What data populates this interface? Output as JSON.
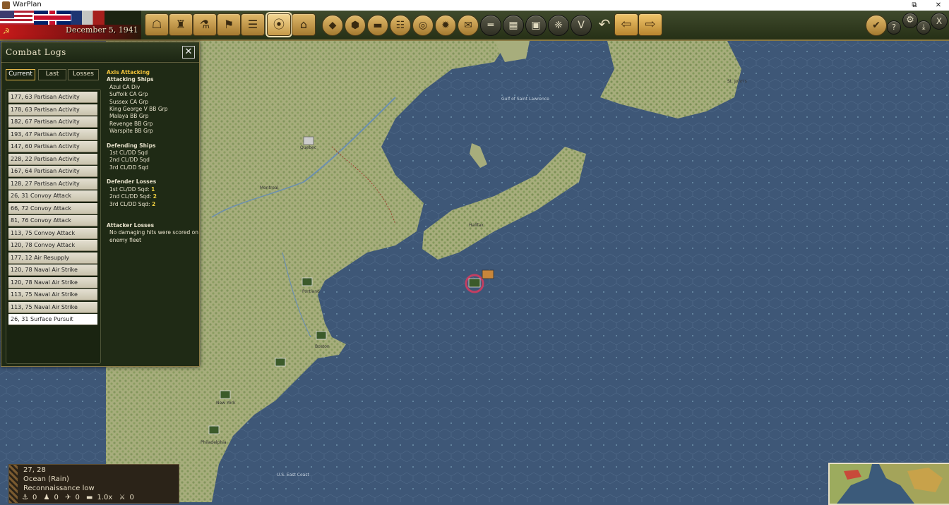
{
  "window": {
    "title": "WarPlan",
    "controls": [
      "–",
      "⧉",
      "✕"
    ]
  },
  "toolbar": {
    "date": "December 5, 1941",
    "main_buttons": [
      {
        "name": "production-button",
        "glyph": "☖"
      },
      {
        "name": "units-button",
        "glyph": "♜"
      },
      {
        "name": "research-button",
        "glyph": "⚗"
      },
      {
        "name": "diplomacy-flag-button",
        "glyph": "⚑"
      },
      {
        "name": "reports-button",
        "glyph": "☰"
      },
      {
        "name": "combat-logs-button",
        "glyph": "⦿"
      },
      {
        "name": "helmet-button",
        "glyph": "⌂"
      }
    ],
    "round_buttons": [
      {
        "name": "terrain-filter-button",
        "glyph": "◆"
      },
      {
        "name": "hex-filter-button",
        "glyph": "⬢"
      },
      {
        "name": "tank-filter-button",
        "glyph": "▬"
      },
      {
        "name": "supply-filter-button",
        "glyph": "☷"
      },
      {
        "name": "target-filter-button",
        "glyph": "◎"
      },
      {
        "name": "sun-filter-button",
        "glyph": "✹"
      },
      {
        "name": "mail-filter-button",
        "glyph": "✉"
      },
      {
        "name": "rail-filter-button",
        "glyph": "═"
      },
      {
        "name": "grid-filter-button",
        "glyph": "▦"
      },
      {
        "name": "frame-filter-button",
        "glyph": "▣"
      },
      {
        "name": "explosion-filter-button",
        "glyph": "❈"
      },
      {
        "name": "victory-filter-button",
        "glyph": "V"
      }
    ],
    "undo_glyph": "↶",
    "prev_glyph": "⇦",
    "next_glyph": "⇨",
    "right_buttons": [
      {
        "name": "end-turn-check-button",
        "glyph": "✔"
      },
      {
        "name": "help-button",
        "glyph": "?"
      },
      {
        "name": "settings-button",
        "glyph": "⚙"
      },
      {
        "name": "save-button",
        "glyph": "⤓"
      },
      {
        "name": "exit-button",
        "glyph": "X"
      }
    ]
  },
  "combat_logs": {
    "title": "Combat Logs",
    "close": "✕",
    "tabs": [
      "Current",
      "Last",
      "Losses"
    ],
    "active_tab": 0,
    "entries": [
      "177, 63 Partisan Activity",
      "178, 63 Partisan Activity",
      "182, 67 Partisan Activity",
      "193, 47 Partisan Activity",
      "147, 60 Partisan Activity",
      "228, 22 Partisan Activity",
      "167, 64 Partisan Activity",
      "128, 27 Partisan Activity",
      "26, 31 Convoy Attack",
      "66, 72 Convoy Attack",
      "81, 76 Convoy Attack",
      "113, 75 Convoy Attack",
      "120, 78 Convoy Attack",
      "177, 12 Air Resupply",
      "120, 78 Naval Air Strike",
      "120, 78 Naval Air Strike",
      "113, 75 Naval Air Strike",
      "113, 75 Naval Air Strike",
      "26, 31 Surface Pursuit"
    ],
    "selected_entry": 18,
    "detail": {
      "side": "Axis Attacking",
      "attacking_header": "Attacking Ships",
      "attacking": [
        "Azul CA Div",
        "Suffolk CA Grp",
        "Sussex CA Grp",
        "King George V BB Grp",
        "Malaya BB Grp",
        "Revenge BB Grp",
        "Warspite BB Grp"
      ],
      "defending_header": "Defending Ships",
      "defending": [
        "1st CL/DD Sqd",
        "2nd CL/DD Sqd",
        "3rd CL/DD Sqd"
      ],
      "def_losses_header": "Defender Losses",
      "def_losses": [
        {
          "unit": "1st CL/DD Sqd:",
          "n": "1"
        },
        {
          "unit": "2nd CL/DD Sqd:",
          "n": "2"
        },
        {
          "unit": "3rd CL/DD Sqd:",
          "n": "2"
        }
      ],
      "att_losses_header": "Attacker Losses",
      "att_losses_text": "No damaging hits were scored on enemy fleet"
    }
  },
  "hex_info": {
    "coords": "27, 28",
    "terrain": "Ocean (Rain)",
    "recon": "Reconnaissance low",
    "stats": [
      {
        "icon": "anchor-icon",
        "glyph": "⚓",
        "value": "0"
      },
      {
        "icon": "soldier-icon",
        "glyph": "♟",
        "value": "0"
      },
      {
        "icon": "plane-icon",
        "glyph": "✈",
        "value": "0"
      },
      {
        "icon": "multiplier-icon",
        "glyph": "▬",
        "value": "1.0x"
      },
      {
        "icon": "artillery-icon",
        "glyph": "⚔",
        "value": "0"
      }
    ]
  },
  "map_labels": {
    "gulf": "Gulf of Saint Lawrence",
    "coast": "U.S. East Coast",
    "cities": [
      "Quebec",
      "Montreal",
      "Portland",
      "Boston",
      "New York",
      "Philadelphia",
      "Halifax",
      "St. John's"
    ]
  },
  "colors": {
    "ocean": "#3e5777",
    "land": "#a7ad7c",
    "forest": "#6f8a49",
    "accent": "#e3b54a"
  }
}
